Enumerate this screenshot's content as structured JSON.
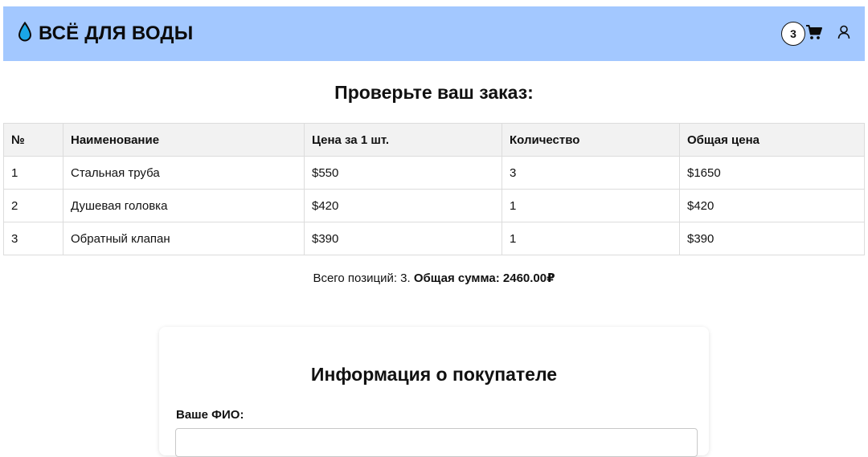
{
  "header": {
    "brand_title": "ВСЁ ДЛЯ ВОДЫ",
    "brand_icon": "water-drop-icon",
    "cart_count": "3",
    "cart_icon": "shopping-cart-icon",
    "user_icon": "user-icon",
    "background_color": "#a3c8ff",
    "drop_color": "#1aa7e8"
  },
  "order": {
    "title": "Проверьте ваш заказ:",
    "columns": [
      "№",
      "Наименование",
      "Цена за 1 шт.",
      "Количество",
      "Общая цена"
    ],
    "rows": [
      [
        "1",
        "Стальная труба",
        "$550",
        "3",
        "$1650"
      ],
      [
        "2",
        "Душевая головка",
        "$420",
        "1",
        "$420"
      ],
      [
        "3",
        "Обратный клапан",
        "$390",
        "1",
        "$390"
      ]
    ],
    "summary_prefix": "Всего позиций: 3.",
    "summary_total": "Общая сумма: 2460.00₽"
  },
  "customer": {
    "title": "Информация о покупателе",
    "name_label": "Ваше ФИО:",
    "name_value": ""
  }
}
